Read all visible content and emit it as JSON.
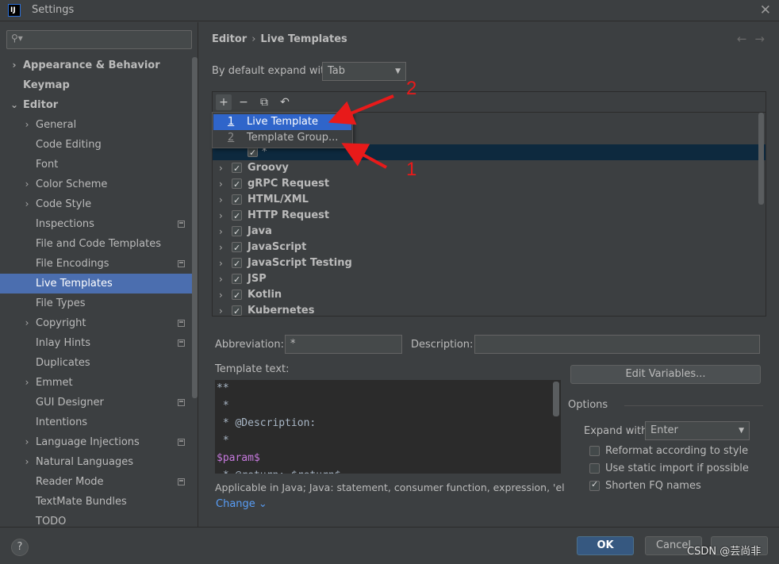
{
  "window": {
    "title": "Settings",
    "app_icon_text": "IJ"
  },
  "sidebar": {
    "search_placeholder": "",
    "items": [
      {
        "label": "Appearance & Behavior",
        "level": 0,
        "expandable": true,
        "expanded": false,
        "bold": true,
        "project_icon": false,
        "selected": false
      },
      {
        "label": "Keymap",
        "level": 0,
        "expandable": false,
        "bold": true,
        "project_icon": false,
        "selected": false
      },
      {
        "label": "Editor",
        "level": 0,
        "expandable": true,
        "expanded": true,
        "bold": true,
        "project_icon": false,
        "selected": false
      },
      {
        "label": "General",
        "level": 1,
        "expandable": true,
        "expanded": false,
        "bold": false,
        "project_icon": false,
        "selected": false
      },
      {
        "label": "Code Editing",
        "level": 1,
        "expandable": false,
        "bold": false,
        "project_icon": false,
        "selected": false
      },
      {
        "label": "Font",
        "level": 1,
        "expandable": false,
        "bold": false,
        "project_icon": false,
        "selected": false
      },
      {
        "label": "Color Scheme",
        "level": 1,
        "expandable": true,
        "expanded": false,
        "bold": false,
        "project_icon": false,
        "selected": false
      },
      {
        "label": "Code Style",
        "level": 1,
        "expandable": true,
        "expanded": false,
        "bold": false,
        "project_icon": false,
        "selected": false
      },
      {
        "label": "Inspections",
        "level": 1,
        "expandable": false,
        "bold": false,
        "project_icon": true,
        "selected": false
      },
      {
        "label": "File and Code Templates",
        "level": 1,
        "expandable": false,
        "bold": false,
        "project_icon": false,
        "selected": false
      },
      {
        "label": "File Encodings",
        "level": 1,
        "expandable": false,
        "bold": false,
        "project_icon": true,
        "selected": false
      },
      {
        "label": "Live Templates",
        "level": 1,
        "expandable": false,
        "bold": false,
        "project_icon": false,
        "selected": true
      },
      {
        "label": "File Types",
        "level": 1,
        "expandable": false,
        "bold": false,
        "project_icon": false,
        "selected": false
      },
      {
        "label": "Copyright",
        "level": 1,
        "expandable": true,
        "expanded": false,
        "bold": false,
        "project_icon": true,
        "selected": false
      },
      {
        "label": "Inlay Hints",
        "level": 1,
        "expandable": false,
        "bold": false,
        "project_icon": true,
        "selected": false
      },
      {
        "label": "Duplicates",
        "level": 1,
        "expandable": false,
        "bold": false,
        "project_icon": false,
        "selected": false
      },
      {
        "label": "Emmet",
        "level": 1,
        "expandable": true,
        "expanded": false,
        "bold": false,
        "project_icon": false,
        "selected": false
      },
      {
        "label": "GUI Designer",
        "level": 1,
        "expandable": false,
        "bold": false,
        "project_icon": true,
        "selected": false
      },
      {
        "label": "Intentions",
        "level": 1,
        "expandable": false,
        "bold": false,
        "project_icon": false,
        "selected": false
      },
      {
        "label": "Language Injections",
        "level": 1,
        "expandable": true,
        "expanded": false,
        "bold": false,
        "project_icon": true,
        "selected": false
      },
      {
        "label": "Natural Languages",
        "level": 1,
        "expandable": true,
        "expanded": false,
        "bold": false,
        "project_icon": false,
        "selected": false
      },
      {
        "label": "Reader Mode",
        "level": 1,
        "expandable": false,
        "bold": false,
        "project_icon": true,
        "selected": false
      },
      {
        "label": "TextMate Bundles",
        "level": 1,
        "expandable": false,
        "bold": false,
        "project_icon": false,
        "selected": false
      },
      {
        "label": "TODO",
        "level": 1,
        "expandable": false,
        "bold": false,
        "project_icon": false,
        "selected": false
      }
    ]
  },
  "main": {
    "breadcrumb": {
      "parent": "Editor",
      "separator": "›",
      "current": "Live Templates"
    },
    "nav": {
      "back": "←",
      "forward": "→"
    },
    "expand_default": {
      "label": "By default expand with",
      "value": "Tab"
    },
    "toolbar": {
      "add": "+",
      "remove": "−",
      "copy": "⧉",
      "restore": "↶"
    },
    "add_popup": [
      {
        "number": "1",
        "label": "Live Template",
        "highlighted": true
      },
      {
        "number": "2",
        "label": "Template Group...",
        "highlighted": false
      }
    ],
    "selected_row_label": "*",
    "groups": [
      {
        "name": "Groovy",
        "checked": true
      },
      {
        "name": "gRPC Request",
        "checked": true
      },
      {
        "name": "HTML/XML",
        "checked": true
      },
      {
        "name": "HTTP Request",
        "checked": true
      },
      {
        "name": "Java",
        "checked": true
      },
      {
        "name": "JavaScript",
        "checked": true
      },
      {
        "name": "JavaScript Testing",
        "checked": true
      },
      {
        "name": "JSP",
        "checked": true
      },
      {
        "name": "Kotlin",
        "checked": true
      },
      {
        "name": "Kubernetes",
        "checked": true
      }
    ],
    "abbreviation": {
      "label": "Abbreviation:",
      "value": "*"
    },
    "description": {
      "label": "Description:",
      "value": ""
    },
    "template_text": {
      "label": "Template text:",
      "lines": [
        {
          "text": "**",
          "param": false
        },
        {
          "text": " *",
          "param": false
        },
        {
          "text": " * @Description:",
          "param": false
        },
        {
          "text": " *",
          "param": false
        },
        {
          "text": "$param$",
          "param": true
        },
        {
          "text": " * @return: $return$",
          "param": false
        }
      ]
    },
    "edit_variables": "Edit Variables...",
    "options": {
      "title": "Options",
      "expand_with": {
        "label": "Expand with",
        "value": "Enter"
      },
      "checkboxes": [
        {
          "label": "Reformat according to style",
          "checked": false
        },
        {
          "label": "Use static import if possible",
          "checked": false
        },
        {
          "label": "Shorten FQ names",
          "checked": true
        }
      ]
    },
    "applicable": "Applicable in Java; Java: statement, consumer function, expression, 'else' ...",
    "change_link": "Change",
    "change_chevron": "⌄"
  },
  "footer": {
    "help": "?",
    "ok": "OK",
    "cancel": "Cancel",
    "watermark": "CSDN @芸尚非"
  },
  "annotations": {
    "label_one": "1",
    "label_two": "2",
    "color": "#e81a1a"
  }
}
